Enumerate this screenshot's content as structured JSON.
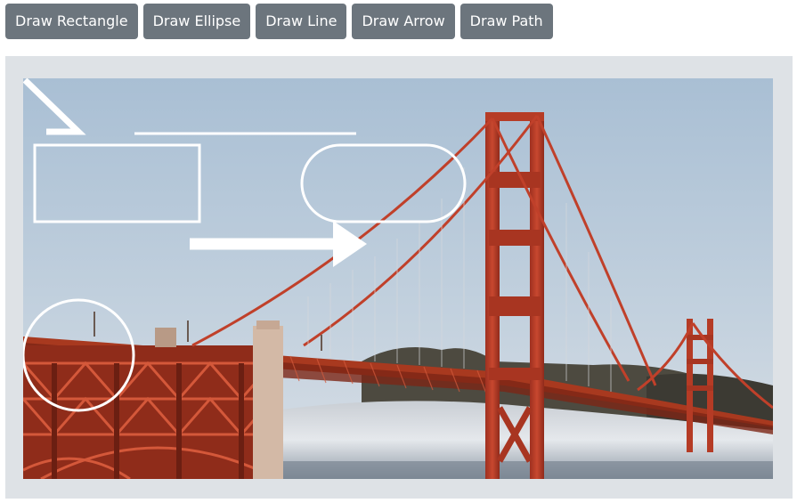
{
  "toolbar": {
    "buttons": [
      {
        "label": "Draw Rectangle"
      },
      {
        "label": "Draw Ellipse"
      },
      {
        "label": "Draw Line"
      },
      {
        "label": "Draw Arrow"
      },
      {
        "label": "Draw Path"
      }
    ]
  },
  "canvas": {
    "image_subject": "golden-gate-bridge-photo",
    "annotation_color": "#ffffff",
    "colors": {
      "button_bg": "#6c757d",
      "button_text": "#ffffff",
      "frame_bg": "#dee2e6",
      "sky": "#b7c8d9",
      "bridge": "#c0402a",
      "fog": "#d9dde2",
      "hills": "#4d4a40"
    }
  }
}
